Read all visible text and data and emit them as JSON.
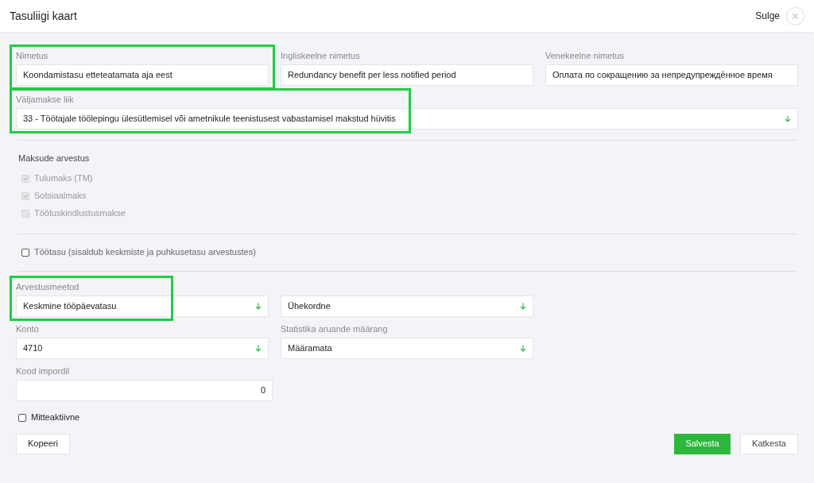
{
  "window": {
    "title": "Tasuliigi kaart",
    "close_label": "Sulge"
  },
  "name_fields": [
    {
      "label": "Nimetus",
      "value": "Koondamistasu etteteatamata aja eest",
      "highlighted": true
    },
    {
      "label": "Ingliskeelne nimetus",
      "value": "Redundancy benefit per less notified period",
      "highlighted": false
    },
    {
      "label": "Venekeelne nimetus",
      "value": "Оплата по сокращению за непредупреждённое время",
      "highlighted": false
    }
  ],
  "payment_type": {
    "label": "Väljamakse liik",
    "value": "33 - Töötajale töölepingu ülesütlemisel või ametnikule teenistusest vabastamisel makstud hüvitis",
    "highlighted": true
  },
  "taxes": {
    "title": "Maksude arvestus",
    "items": [
      {
        "label": "Tulumaks (TM)",
        "checked": true,
        "disabled": true
      },
      {
        "label": "Sotsiaalmaks",
        "checked": true,
        "disabled": true
      },
      {
        "label": "Töötuskindlustusmakse",
        "checked": false,
        "disabled": true
      }
    ]
  },
  "salary": {
    "label": "Töötasu (sisaldub keskmiste ja puhkusetasu arvestustes)",
    "checked": false
  },
  "selects": [
    {
      "label": "Arvestusmeetod",
      "value": "Keskmine tööpäevatasu",
      "highlighted": true
    },
    {
      "value": "Ühekordne",
      "highlighted": false
    },
    {
      "label": "Konto",
      "value": "4710",
      "highlighted": false
    },
    {
      "label": "Statistika aruande määrang",
      "value": "Määramata",
      "highlighted": false
    }
  ],
  "import_code": {
    "label": "Kood impordil",
    "value": "0"
  },
  "inactive": {
    "label": "Mitteaktiivne",
    "checked": false
  },
  "buttons": {
    "copy": "Kopeeri",
    "save": "Salvesta",
    "cancel": "Katkesta"
  }
}
